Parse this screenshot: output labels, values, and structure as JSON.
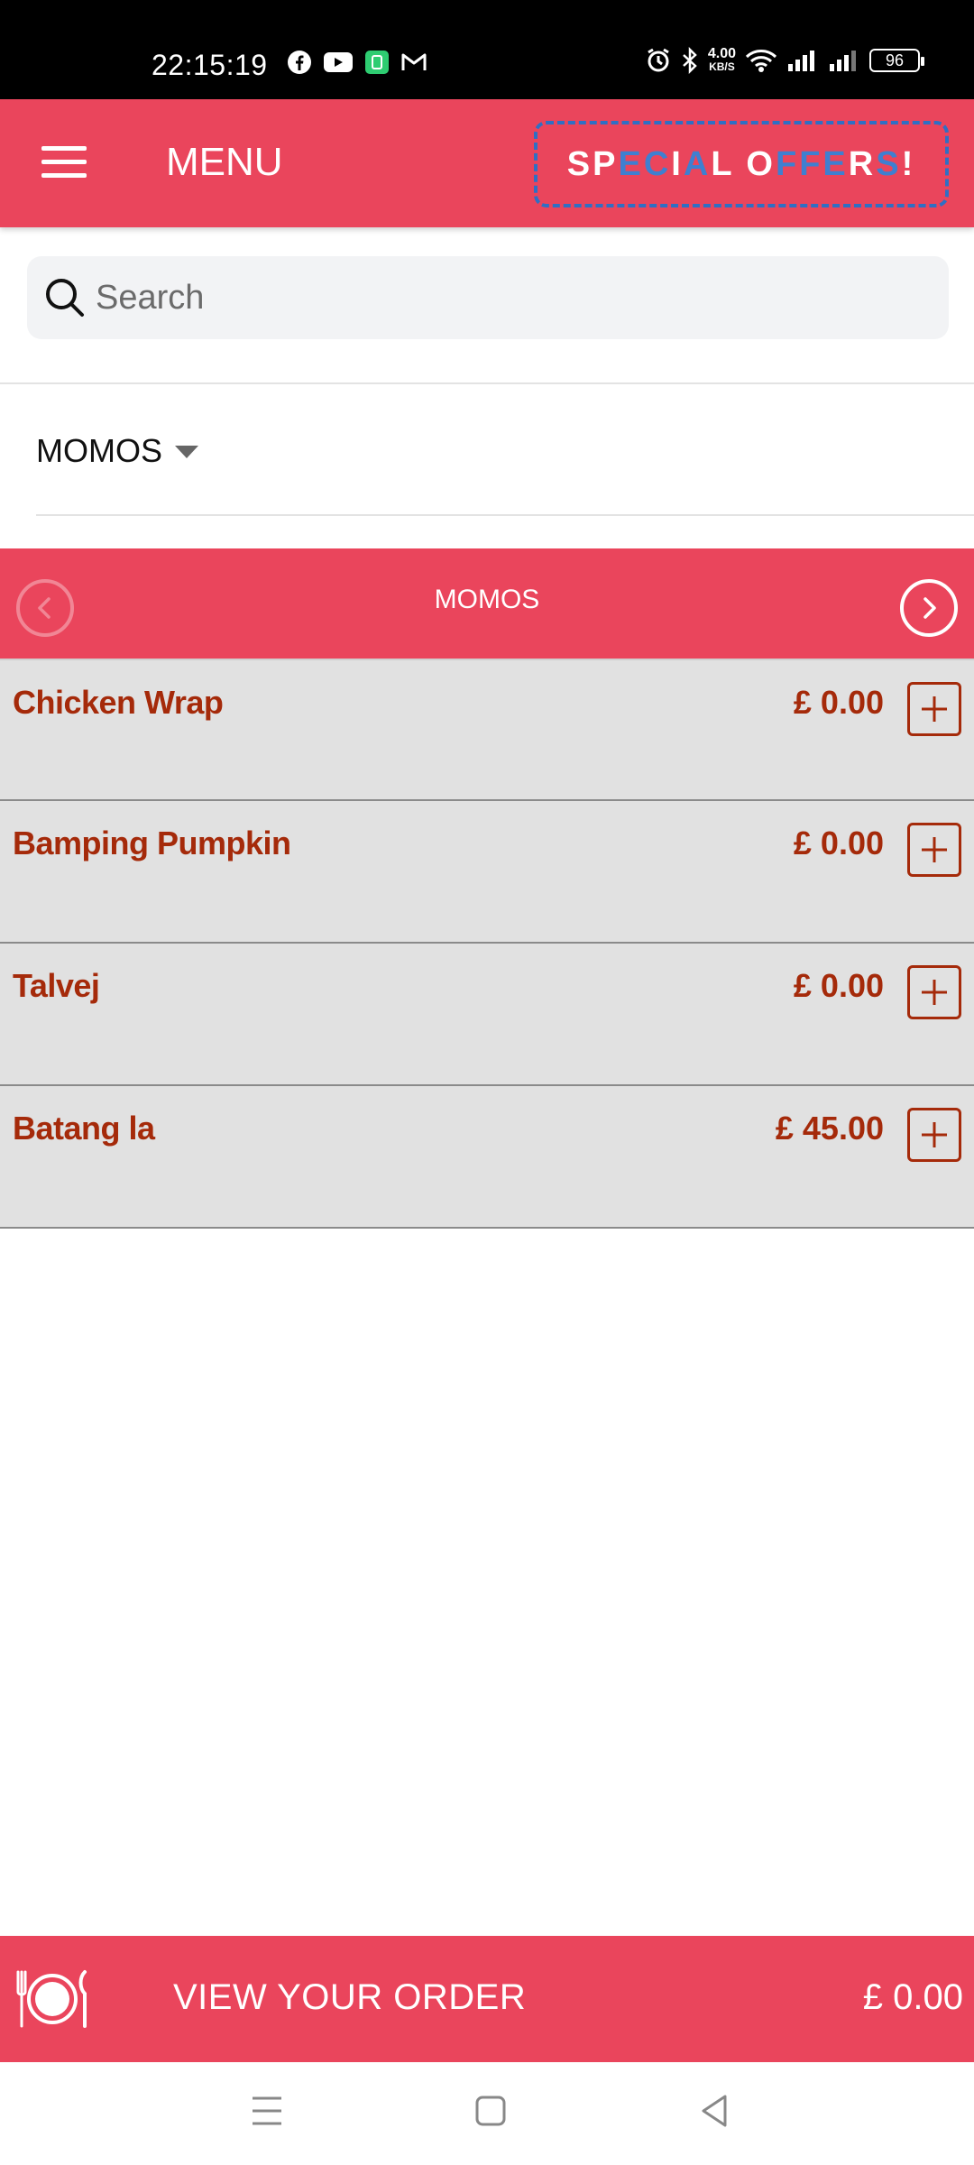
{
  "status_bar": {
    "time": "22:15:19",
    "speed_value": "4.00",
    "speed_unit": "KB/S",
    "battery": "96",
    "app_icons": [
      "facebook-icon",
      "youtube-icon",
      "app-icon",
      "gmail-icon"
    ],
    "system_icons": [
      "alarm-icon",
      "bluetooth-icon",
      "wifi-icon",
      "signal-icon",
      "signal-icon",
      "battery-icon"
    ]
  },
  "header": {
    "menu_label": "MENU",
    "special_offers": "SPECIAL OFFERS!"
  },
  "search": {
    "placeholder": "Search",
    "value": ""
  },
  "category_dropdown": {
    "selected": "MOMOS"
  },
  "category_nav": {
    "title": "MOMOS"
  },
  "items": [
    {
      "name": "Chicken Wrap",
      "price": "£ 0.00"
    },
    {
      "name": "Bamping Pumpkin",
      "price": "£ 0.00"
    },
    {
      "name": "Talvej",
      "price": "£ 0.00"
    },
    {
      "name": "Batang la",
      "price": "£ 45.00"
    }
  ],
  "order_bar": {
    "label": "VIEW YOUR ORDER",
    "total": "£ 0.00"
  },
  "colors": {
    "accent": "#ea455c",
    "item_text": "#a52a0a",
    "item_bg": "#e1e1e1",
    "offers_border": "#2f6fc4"
  }
}
